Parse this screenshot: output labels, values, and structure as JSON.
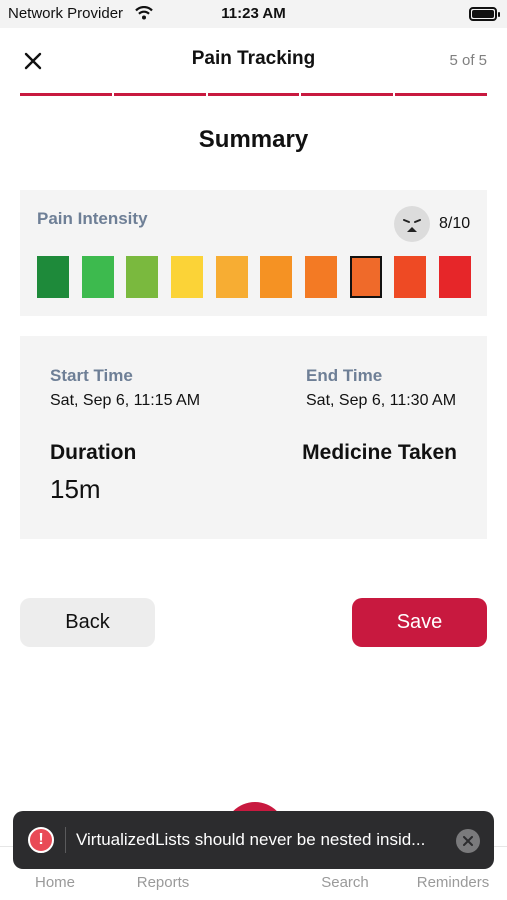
{
  "status_bar": {
    "carrier": "Network Provider",
    "time": "11:23 AM"
  },
  "header": {
    "title": "Pain Tracking",
    "step": "5 of 5"
  },
  "progress": {
    "completed_steps": 5,
    "total_steps": 5
  },
  "page_title": "Summary",
  "pain": {
    "label": "Pain Intensity",
    "score": "8/10",
    "selected_level": 8,
    "level_colors": [
      "#1e8a3a",
      "#3dba4e",
      "#7ab93e",
      "#fbd337",
      "#f7ad33",
      "#f59223",
      "#f37a24",
      "#ef6a2a",
      "#ee4a24",
      "#e62629"
    ]
  },
  "times": {
    "start_label": "Start Time",
    "start_value": "Sat, Sep 6, 11:15 AM",
    "end_label": "End Time",
    "end_value": "Sat, Sep 6, 11:30 AM",
    "duration_label": "Duration",
    "duration_value": "15m",
    "medicine_label": "Medicine Taken"
  },
  "buttons": {
    "back": "Back",
    "save": "Save"
  },
  "tabs": [
    "Home",
    "Reports",
    "Search",
    "Reminders"
  ],
  "toast": {
    "icon": "!",
    "message": "VirtualizedLists should never be nested insid..."
  },
  "colors": {
    "accent": "#c8193f",
    "label": "#6e7f96"
  }
}
